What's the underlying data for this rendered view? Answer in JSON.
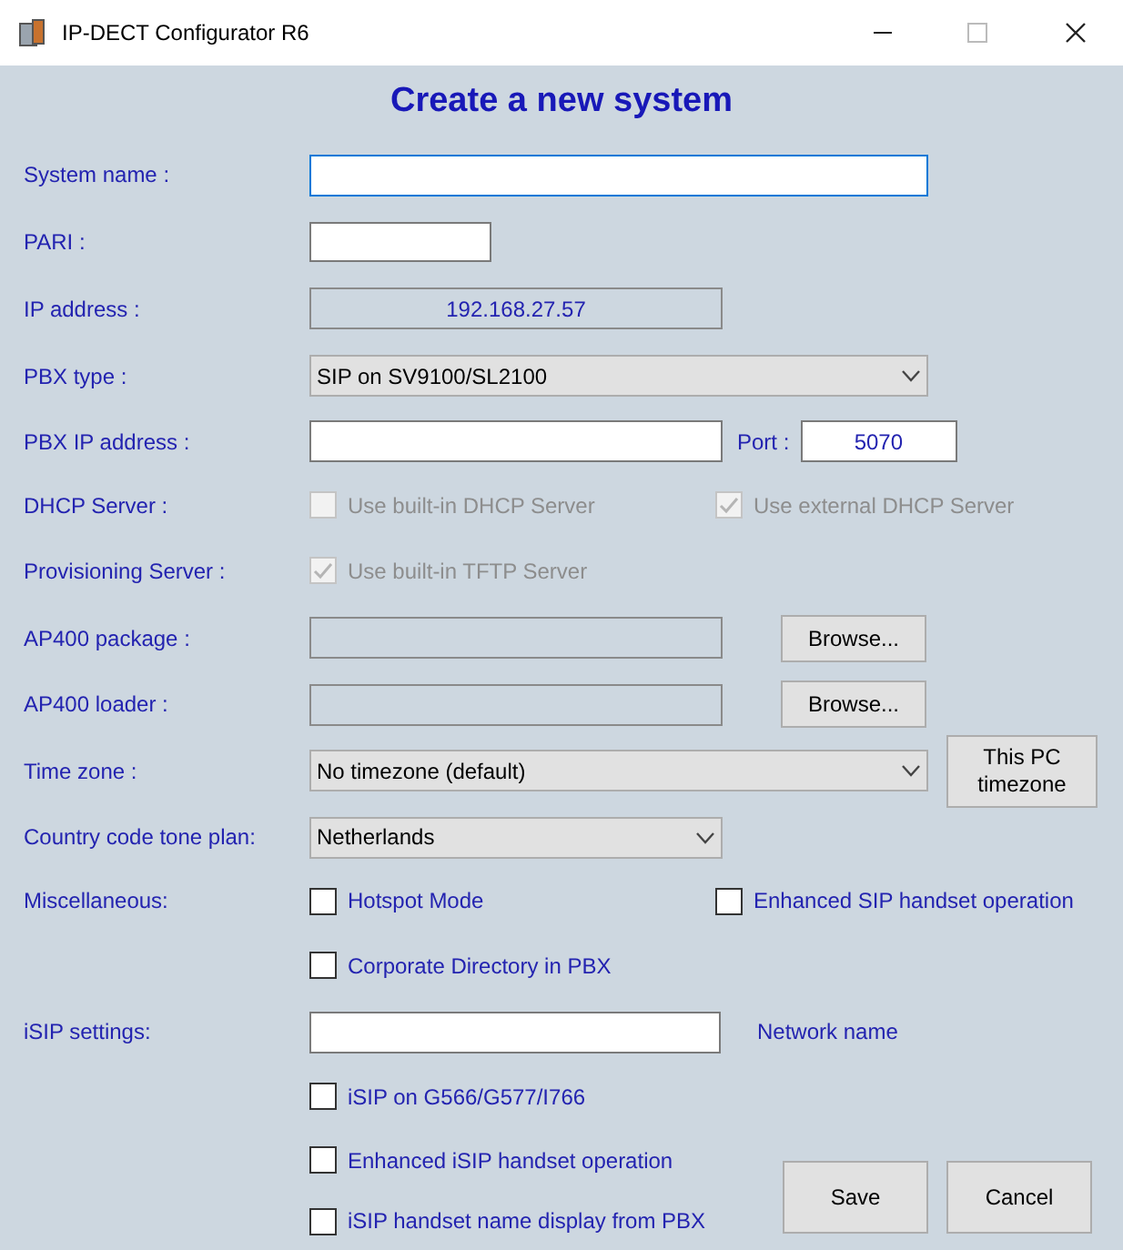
{
  "window": {
    "title": "IP-DECT Configurator R6"
  },
  "heading": "Create a new system",
  "system_name": {
    "label": "System name :",
    "focused": true
  },
  "pari": {
    "label": "PARI :"
  },
  "ip_address": {
    "label": "IP address :",
    "value": "192.168.27.57",
    "disabled": true
  },
  "pbx_type": {
    "label": "PBX type :",
    "value": "SIP on SV9100/SL2100"
  },
  "pbx_ip": {
    "label": "PBX IP address :",
    "port_label": "Port :",
    "port_value": "5070"
  },
  "dhcp": {
    "label": "DHCP Server :",
    "options": [
      {
        "label": "Use built-in DHCP Server",
        "checked": false,
        "disabled": true
      },
      {
        "label": "Use external DHCP Server",
        "checked": true,
        "disabled": true
      }
    ]
  },
  "provisioning": {
    "label": "Provisioning Server :",
    "options": [
      {
        "label": "Use built-in TFTP Server",
        "checked": true,
        "disabled": true
      }
    ]
  },
  "ap400_package": {
    "label": "AP400 package :",
    "button": "Browse..."
  },
  "ap400_loader": {
    "label": "AP400 loader :",
    "button": "Browse..."
  },
  "time_zone": {
    "label": "Time zone :",
    "value": "No timezone (default)",
    "button": "This PC timezone"
  },
  "tone_plan": {
    "label": "Country code tone plan:",
    "value": "Netherlands"
  },
  "miscellaneous": {
    "label": "Miscellaneous:",
    "options": [
      {
        "label": "Hotspot Mode",
        "checked": false,
        "disabled": false
      },
      {
        "label": "Enhanced SIP handset operation",
        "checked": false,
        "disabled": false
      },
      {
        "label": "Corporate Directory in PBX",
        "checked": false,
        "disabled": false
      }
    ]
  },
  "isip": {
    "label": "iSIP settings:",
    "network_label": "Network name",
    "options": [
      {
        "label": "iSIP on G566/G577/I766",
        "checked": false,
        "disabled": false
      },
      {
        "label": "Enhanced iSIP handset operation",
        "checked": false,
        "disabled": false
      },
      {
        "label": "iSIP handset name display from PBX",
        "checked": false,
        "disabled": false
      }
    ]
  },
  "buttons": [
    "Save",
    "Cancel"
  ]
}
